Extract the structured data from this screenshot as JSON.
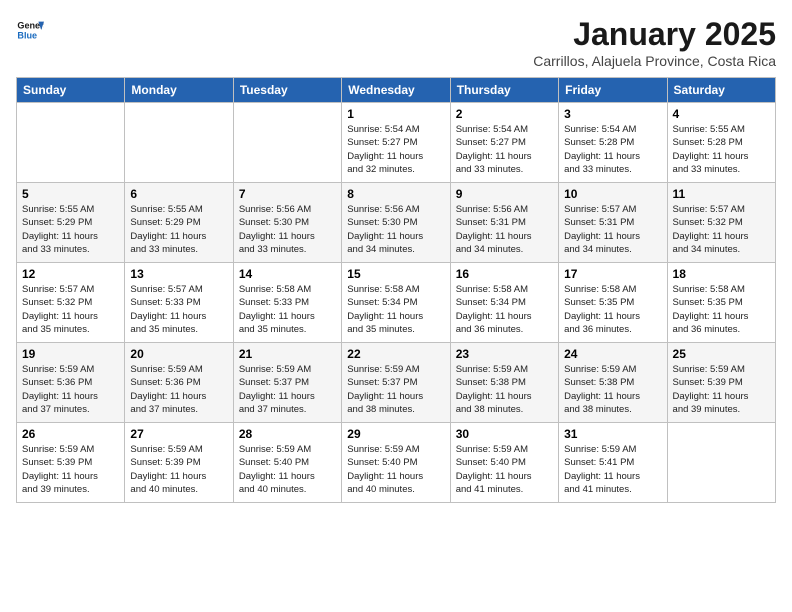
{
  "header": {
    "logo_line1": "General",
    "logo_line2": "Blue",
    "title": "January 2025",
    "subtitle": "Carrillos, Alajuela Province, Costa Rica"
  },
  "weekdays": [
    "Sunday",
    "Monday",
    "Tuesday",
    "Wednesday",
    "Thursday",
    "Friday",
    "Saturday"
  ],
  "weeks": [
    [
      {
        "day": "",
        "info": ""
      },
      {
        "day": "",
        "info": ""
      },
      {
        "day": "",
        "info": ""
      },
      {
        "day": "1",
        "info": "Sunrise: 5:54 AM\nSunset: 5:27 PM\nDaylight: 11 hours\nand 32 minutes."
      },
      {
        "day": "2",
        "info": "Sunrise: 5:54 AM\nSunset: 5:27 PM\nDaylight: 11 hours\nand 33 minutes."
      },
      {
        "day": "3",
        "info": "Sunrise: 5:54 AM\nSunset: 5:28 PM\nDaylight: 11 hours\nand 33 minutes."
      },
      {
        "day": "4",
        "info": "Sunrise: 5:55 AM\nSunset: 5:28 PM\nDaylight: 11 hours\nand 33 minutes."
      }
    ],
    [
      {
        "day": "5",
        "info": "Sunrise: 5:55 AM\nSunset: 5:29 PM\nDaylight: 11 hours\nand 33 minutes."
      },
      {
        "day": "6",
        "info": "Sunrise: 5:55 AM\nSunset: 5:29 PM\nDaylight: 11 hours\nand 33 minutes."
      },
      {
        "day": "7",
        "info": "Sunrise: 5:56 AM\nSunset: 5:30 PM\nDaylight: 11 hours\nand 33 minutes."
      },
      {
        "day": "8",
        "info": "Sunrise: 5:56 AM\nSunset: 5:30 PM\nDaylight: 11 hours\nand 34 minutes."
      },
      {
        "day": "9",
        "info": "Sunrise: 5:56 AM\nSunset: 5:31 PM\nDaylight: 11 hours\nand 34 minutes."
      },
      {
        "day": "10",
        "info": "Sunrise: 5:57 AM\nSunset: 5:31 PM\nDaylight: 11 hours\nand 34 minutes."
      },
      {
        "day": "11",
        "info": "Sunrise: 5:57 AM\nSunset: 5:32 PM\nDaylight: 11 hours\nand 34 minutes."
      }
    ],
    [
      {
        "day": "12",
        "info": "Sunrise: 5:57 AM\nSunset: 5:32 PM\nDaylight: 11 hours\nand 35 minutes."
      },
      {
        "day": "13",
        "info": "Sunrise: 5:57 AM\nSunset: 5:33 PM\nDaylight: 11 hours\nand 35 minutes."
      },
      {
        "day": "14",
        "info": "Sunrise: 5:58 AM\nSunset: 5:33 PM\nDaylight: 11 hours\nand 35 minutes."
      },
      {
        "day": "15",
        "info": "Sunrise: 5:58 AM\nSunset: 5:34 PM\nDaylight: 11 hours\nand 35 minutes."
      },
      {
        "day": "16",
        "info": "Sunrise: 5:58 AM\nSunset: 5:34 PM\nDaylight: 11 hours\nand 36 minutes."
      },
      {
        "day": "17",
        "info": "Sunrise: 5:58 AM\nSunset: 5:35 PM\nDaylight: 11 hours\nand 36 minutes."
      },
      {
        "day": "18",
        "info": "Sunrise: 5:58 AM\nSunset: 5:35 PM\nDaylight: 11 hours\nand 36 minutes."
      }
    ],
    [
      {
        "day": "19",
        "info": "Sunrise: 5:59 AM\nSunset: 5:36 PM\nDaylight: 11 hours\nand 37 minutes."
      },
      {
        "day": "20",
        "info": "Sunrise: 5:59 AM\nSunset: 5:36 PM\nDaylight: 11 hours\nand 37 minutes."
      },
      {
        "day": "21",
        "info": "Sunrise: 5:59 AM\nSunset: 5:37 PM\nDaylight: 11 hours\nand 37 minutes."
      },
      {
        "day": "22",
        "info": "Sunrise: 5:59 AM\nSunset: 5:37 PM\nDaylight: 11 hours\nand 38 minutes."
      },
      {
        "day": "23",
        "info": "Sunrise: 5:59 AM\nSunset: 5:38 PM\nDaylight: 11 hours\nand 38 minutes."
      },
      {
        "day": "24",
        "info": "Sunrise: 5:59 AM\nSunset: 5:38 PM\nDaylight: 11 hours\nand 38 minutes."
      },
      {
        "day": "25",
        "info": "Sunrise: 5:59 AM\nSunset: 5:39 PM\nDaylight: 11 hours\nand 39 minutes."
      }
    ],
    [
      {
        "day": "26",
        "info": "Sunrise: 5:59 AM\nSunset: 5:39 PM\nDaylight: 11 hours\nand 39 minutes."
      },
      {
        "day": "27",
        "info": "Sunrise: 5:59 AM\nSunset: 5:39 PM\nDaylight: 11 hours\nand 40 minutes."
      },
      {
        "day": "28",
        "info": "Sunrise: 5:59 AM\nSunset: 5:40 PM\nDaylight: 11 hours\nand 40 minutes."
      },
      {
        "day": "29",
        "info": "Sunrise: 5:59 AM\nSunset: 5:40 PM\nDaylight: 11 hours\nand 40 minutes."
      },
      {
        "day": "30",
        "info": "Sunrise: 5:59 AM\nSunset: 5:40 PM\nDaylight: 11 hours\nand 41 minutes."
      },
      {
        "day": "31",
        "info": "Sunrise: 5:59 AM\nSunset: 5:41 PM\nDaylight: 11 hours\nand 41 minutes."
      },
      {
        "day": "",
        "info": ""
      }
    ]
  ]
}
